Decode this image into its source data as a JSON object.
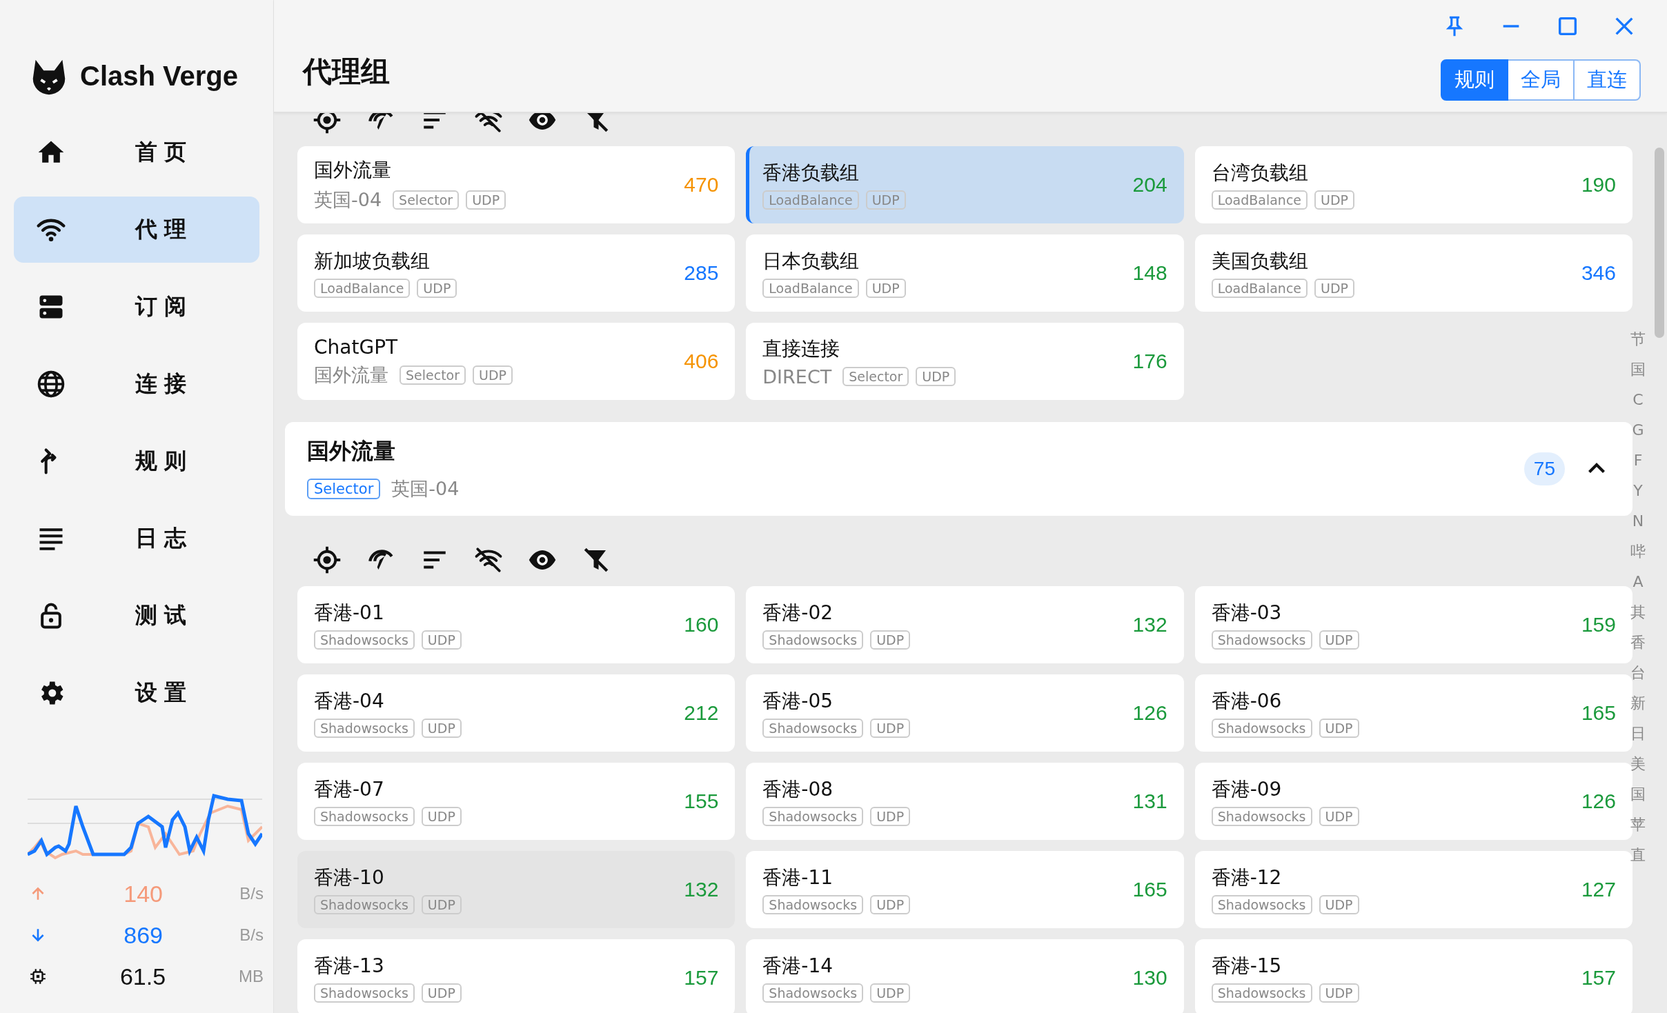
{
  "app": {
    "name": "Clash Verge"
  },
  "nav": [
    {
      "label": "首页",
      "selected": false
    },
    {
      "label": "代理",
      "selected": true
    },
    {
      "label": "订阅",
      "selected": false
    },
    {
      "label": "连接",
      "selected": false
    },
    {
      "label": "规则",
      "selected": false
    },
    {
      "label": "日志",
      "selected": false
    },
    {
      "label": "测试",
      "selected": false
    },
    {
      "label": "设置",
      "selected": false
    }
  ],
  "traffic": {
    "upload": {
      "value": "140",
      "unit": "B/s"
    },
    "download": {
      "value": "869",
      "unit": "B/s"
    },
    "memory": {
      "value": "61.5",
      "unit": "MB"
    }
  },
  "header": {
    "title": "代理组",
    "modes": [
      {
        "label": "规则",
        "selected": true
      },
      {
        "label": "全局",
        "selected": false
      },
      {
        "label": "直连",
        "selected": false
      }
    ]
  },
  "groups": [
    {
      "name": "国外流量",
      "now": "英国-04",
      "tags": [
        "Selector",
        "UDP"
      ],
      "delay": "470",
      "color": "#f59300",
      "selected": false
    },
    {
      "name": "香港负载组",
      "tags": [
        "LoadBalance",
        "UDP"
      ],
      "delay": "204",
      "color": "#1b9a3c",
      "selected": true
    },
    {
      "name": "台湾负载组",
      "tags": [
        "LoadBalance",
        "UDP"
      ],
      "delay": "190",
      "color": "#1b9a3c",
      "selected": false
    },
    {
      "name": "新加坡负载组",
      "tags": [
        "LoadBalance",
        "UDP"
      ],
      "delay": "285",
      "color": "#1677ff",
      "selected": false
    },
    {
      "name": "日本负载组",
      "tags": [
        "LoadBalance",
        "UDP"
      ],
      "delay": "148",
      "color": "#1b9a3c",
      "selected": false
    },
    {
      "name": "美国负载组",
      "tags": [
        "LoadBalance",
        "UDP"
      ],
      "delay": "346",
      "color": "#1677ff",
      "selected": false
    },
    {
      "name": "ChatGPT",
      "now": "国外流量",
      "tags": [
        "Selector",
        "UDP"
      ],
      "delay": "406",
      "color": "#f59300",
      "selected": false
    },
    {
      "name": "直接连接",
      "now": "DIRECT",
      "tags": [
        "Selector",
        "UDP"
      ],
      "delay": "176",
      "color": "#1b9a3c",
      "selected": false
    }
  ],
  "group_panel": {
    "name": "国外流量",
    "type": "Selector",
    "now": "英国-04",
    "count": "75",
    "expanded": true
  },
  "proxies": [
    {
      "name": "香港-01",
      "tags": [
        "Shadowsocks",
        "UDP"
      ],
      "delay": "160",
      "selected": false
    },
    {
      "name": "香港-02",
      "tags": [
        "Shadowsocks",
        "UDP"
      ],
      "delay": "132",
      "selected": false
    },
    {
      "name": "香港-03",
      "tags": [
        "Shadowsocks",
        "UDP"
      ],
      "delay": "159",
      "selected": false
    },
    {
      "name": "香港-04",
      "tags": [
        "Shadowsocks",
        "UDP"
      ],
      "delay": "212",
      "selected": false
    },
    {
      "name": "香港-05",
      "tags": [
        "Shadowsocks",
        "UDP"
      ],
      "delay": "126",
      "selected": false
    },
    {
      "name": "香港-06",
      "tags": [
        "Shadowsocks",
        "UDP"
      ],
      "delay": "165",
      "selected": false
    },
    {
      "name": "香港-07",
      "tags": [
        "Shadowsocks",
        "UDP"
      ],
      "delay": "155",
      "selected": false
    },
    {
      "name": "香港-08",
      "tags": [
        "Shadowsocks",
        "UDP"
      ],
      "delay": "131",
      "selected": false
    },
    {
      "name": "香港-09",
      "tags": [
        "Shadowsocks",
        "UDP"
      ],
      "delay": "126",
      "selected": false
    },
    {
      "name": "香港-10",
      "tags": [
        "Shadowsocks",
        "UDP"
      ],
      "delay": "132",
      "selected": true
    },
    {
      "name": "香港-11",
      "tags": [
        "Shadowsocks",
        "UDP"
      ],
      "delay": "165",
      "selected": false
    },
    {
      "name": "香港-12",
      "tags": [
        "Shadowsocks",
        "UDP"
      ],
      "delay": "127",
      "selected": false
    },
    {
      "name": "香港-13",
      "tags": [
        "Shadowsocks",
        "UDP"
      ],
      "delay": "157",
      "selected": false
    },
    {
      "name": "香港-14",
      "tags": [
        "Shadowsocks",
        "UDP"
      ],
      "delay": "130",
      "selected": false
    },
    {
      "name": "香港-15",
      "tags": [
        "Shadowsocks",
        "UDP"
      ],
      "delay": "157",
      "selected": false
    }
  ],
  "index": [
    "节",
    "国",
    "C",
    "G",
    "F",
    "Y",
    "N",
    "哔",
    "A",
    "其",
    "香",
    "台",
    "新",
    "日",
    "美",
    "国",
    "苹",
    "直"
  ]
}
